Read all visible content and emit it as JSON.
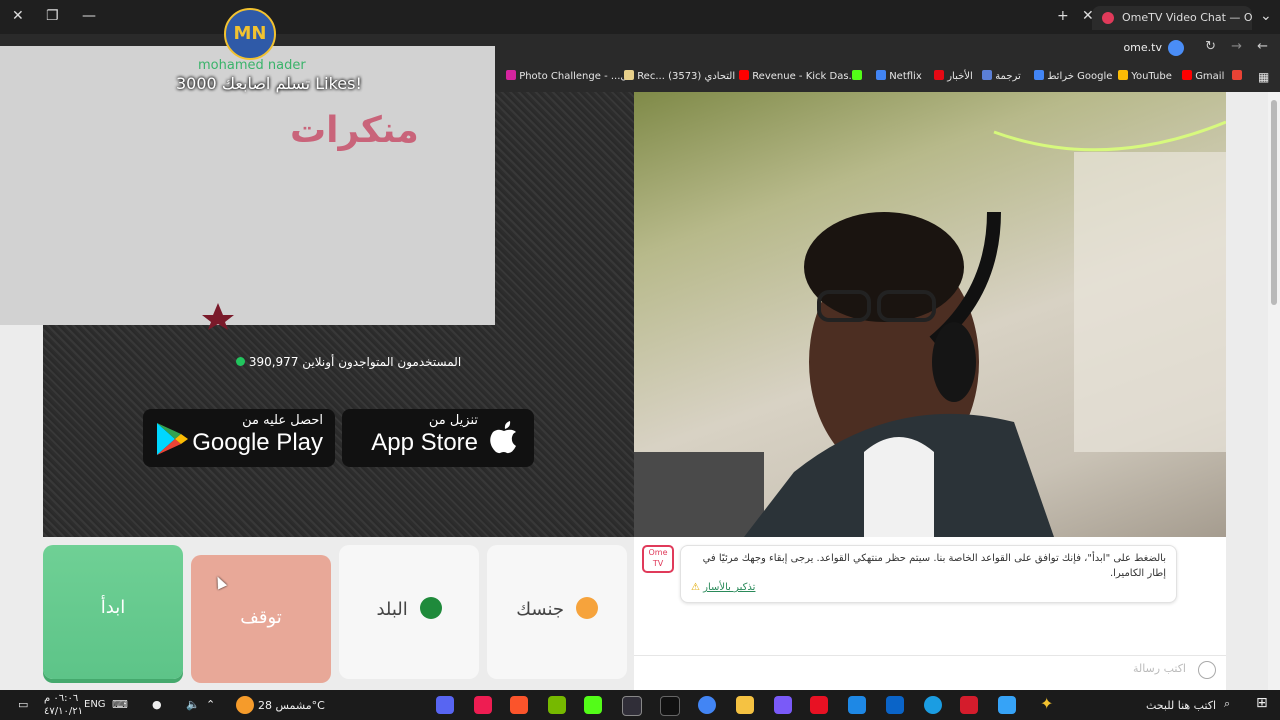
{
  "browser": {
    "tab_title": "OmeTV Video Chat — Ome",
    "address": "ome.tv",
    "bookmarks": [
      "Photo Challenge - ...ل",
      "Rec... انا التحادي (3573)",
      "Revenue - Kick Das...",
      "Netflix",
      "الأخبار",
      "ترجمة",
      "خرائط Google",
      "YouTube",
      "Gmail"
    ]
  },
  "stream_overlay": {
    "logo": "MN",
    "name": "mohamed nader",
    "likes_text": "3000 تسلم اصابعك Likes!",
    "graphic_text": "منكرات"
  },
  "online": {
    "label": "المستخدمون المتواجدون أونلاين",
    "count": "390,977",
    "dot_color": "#22c55e"
  },
  "stores": {
    "google_small": "احصل عليه من",
    "google_big": "Google Play",
    "apple_small": "تنزيل من",
    "apple_big": "App Store"
  },
  "controls": {
    "start": "ابدأ",
    "stop": "توقف",
    "country": "البلد",
    "gender": "جنسك"
  },
  "chat": {
    "rules_message": "بالضغط على \"ابدأ\"، فإنك توافق على القواعد الخاصة بنا. سيتم حظر منتهكي القواعد. يرجى إبقاء وجهك مرئيًا في إطار الكاميرا.",
    "reminder_link": "تذكير بالأسار",
    "input_placeholder": "اكتب رسالة"
  },
  "taskbar": {
    "search_placeholder": "اكتب هنا للبحث",
    "weather": "مشمس 28°C",
    "lang": "ENG",
    "time": "٠٦:٠٦ م",
    "date": "٤٧/١٠/٢١"
  },
  "colors": {
    "start": "#5dc488",
    "stop": "#e8a898",
    "link": "#2a8a5a"
  }
}
